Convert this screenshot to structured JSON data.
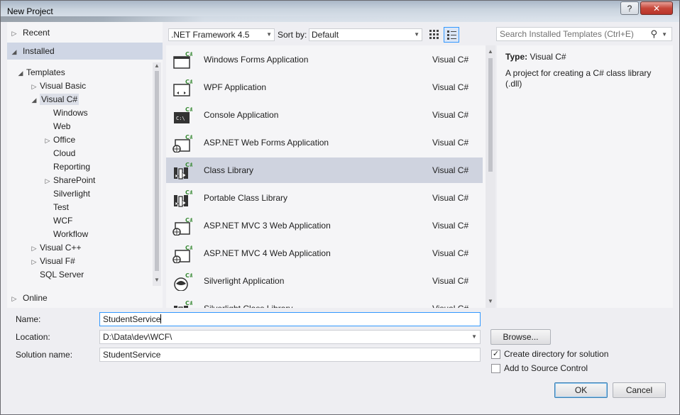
{
  "window": {
    "title": "New Project",
    "help": "?",
    "close": "✕"
  },
  "sidebar": {
    "recent": "Recent",
    "installed": "Installed",
    "online": "Online",
    "tree": [
      {
        "label": "Templates",
        "arrow": "◢"
      },
      {
        "label": "Visual Basic",
        "arrow": "▷"
      },
      {
        "label": "Visual C#",
        "arrow": "◢"
      },
      {
        "label": "Windows",
        "arrow": ""
      },
      {
        "label": "Web",
        "arrow": ""
      },
      {
        "label": "Office",
        "arrow": "▷"
      },
      {
        "label": "Cloud",
        "arrow": ""
      },
      {
        "label": "Reporting",
        "arrow": ""
      },
      {
        "label": "SharePoint",
        "arrow": "▷"
      },
      {
        "label": "Silverlight",
        "arrow": ""
      },
      {
        "label": "Test",
        "arrow": ""
      },
      {
        "label": "WCF",
        "arrow": ""
      },
      {
        "label": "Workflow",
        "arrow": ""
      },
      {
        "label": "Visual C++",
        "arrow": "▷"
      },
      {
        "label": "Visual F#",
        "arrow": "▷"
      },
      {
        "label": "SQL Server",
        "arrow": ""
      }
    ]
  },
  "toolbar": {
    "framework": ".NET Framework 4.5",
    "sort_label": "Sort by:",
    "sort_value": "Default",
    "search_placeholder": "Search Installed Templates (Ctrl+E)"
  },
  "templates": [
    {
      "name": "Windows Forms Application",
      "lang": "Visual C#",
      "icon": "winforms-icon"
    },
    {
      "name": "WPF Application",
      "lang": "Visual C#",
      "icon": "wpf-icon"
    },
    {
      "name": "Console Application",
      "lang": "Visual C#",
      "icon": "console-icon"
    },
    {
      "name": "ASP.NET Web Forms Application",
      "lang": "Visual C#",
      "icon": "web-icon"
    },
    {
      "name": "Class Library",
      "lang": "Visual C#",
      "icon": "class-library-icon"
    },
    {
      "name": "Portable Class Library",
      "lang": "Visual C#",
      "icon": "class-library-icon"
    },
    {
      "name": "ASP.NET MVC 3 Web Application",
      "lang": "Visual C#",
      "icon": "web-icon"
    },
    {
      "name": "ASP.NET MVC 4 Web Application",
      "lang": "Visual C#",
      "icon": "web-icon"
    },
    {
      "name": "Silverlight Application",
      "lang": "Visual C#",
      "icon": "silverlight-icon"
    },
    {
      "name": "Silverlight Class Library",
      "lang": "Visual C#",
      "icon": "class-library-icon"
    }
  ],
  "details": {
    "type_label": "Type:",
    "type_value": "Visual C#",
    "description": "A project for creating a C# class library (.dll)"
  },
  "form": {
    "name_label": "Name:",
    "name_value": "StudentService",
    "location_label": "Location:",
    "location_value": "D:\\Data\\dev\\WCF\\",
    "solution_label": "Solution name:",
    "solution_value": "StudentService",
    "browse": "Browse...",
    "create_dir": "Create directory for solution",
    "add_source": "Add to Source Control",
    "ok": "OK",
    "cancel": "Cancel"
  },
  "colors": {
    "selection": "#cfd6e5",
    "accent": "#3399ff",
    "csharp_green": "#388a34"
  }
}
